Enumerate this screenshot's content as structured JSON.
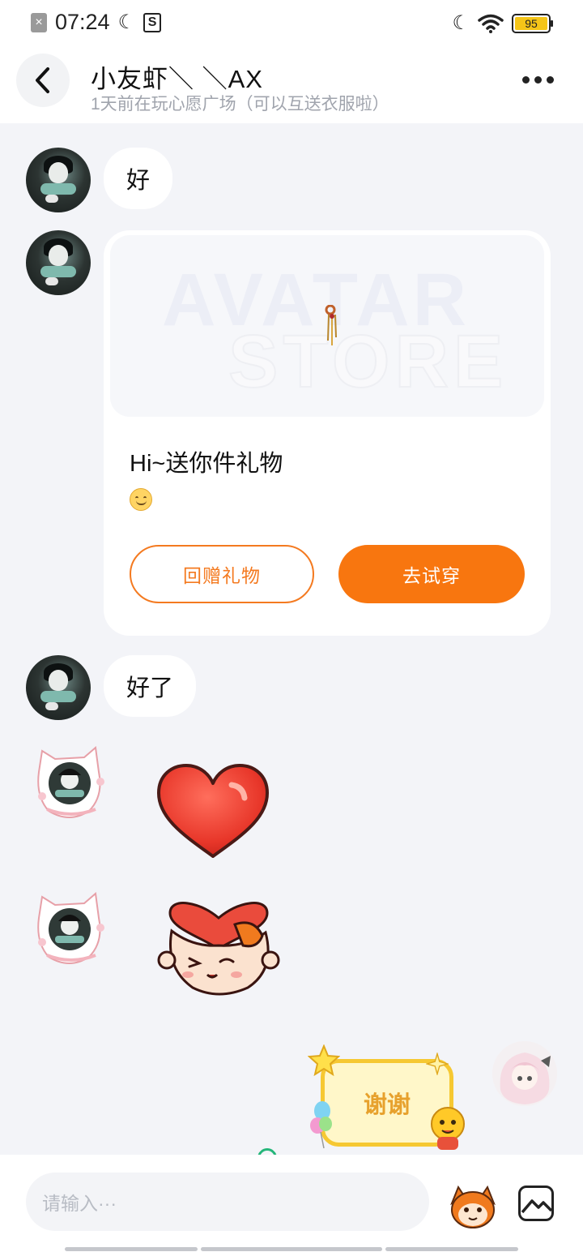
{
  "status_bar": {
    "time": "07:24",
    "battery": "95"
  },
  "header": {
    "title": "小友虾＼ ＼AX",
    "subtitle": "1天前在玩心愿广场（可以互送衣服啦）"
  },
  "messages": [
    {
      "text": "好"
    },
    {
      "gift": {
        "watermark_line1": "AVATAR",
        "watermark_line2": "STORE",
        "text": "Hi~送你件礼物",
        "return_gift_label": "回赠礼物",
        "try_on_label": "去试穿"
      }
    },
    {
      "text": "好了"
    },
    {
      "sticker": "heart-sticker"
    },
    {
      "sticker": "heart-hug-sticker"
    },
    {
      "sticker_text": "谢谢"
    }
  ],
  "input_bar": {
    "placeholder": "请输入···"
  },
  "colors": {
    "accent": "#f8760f",
    "background": "#f3f4f8",
    "bubble": "#ffffff"
  }
}
